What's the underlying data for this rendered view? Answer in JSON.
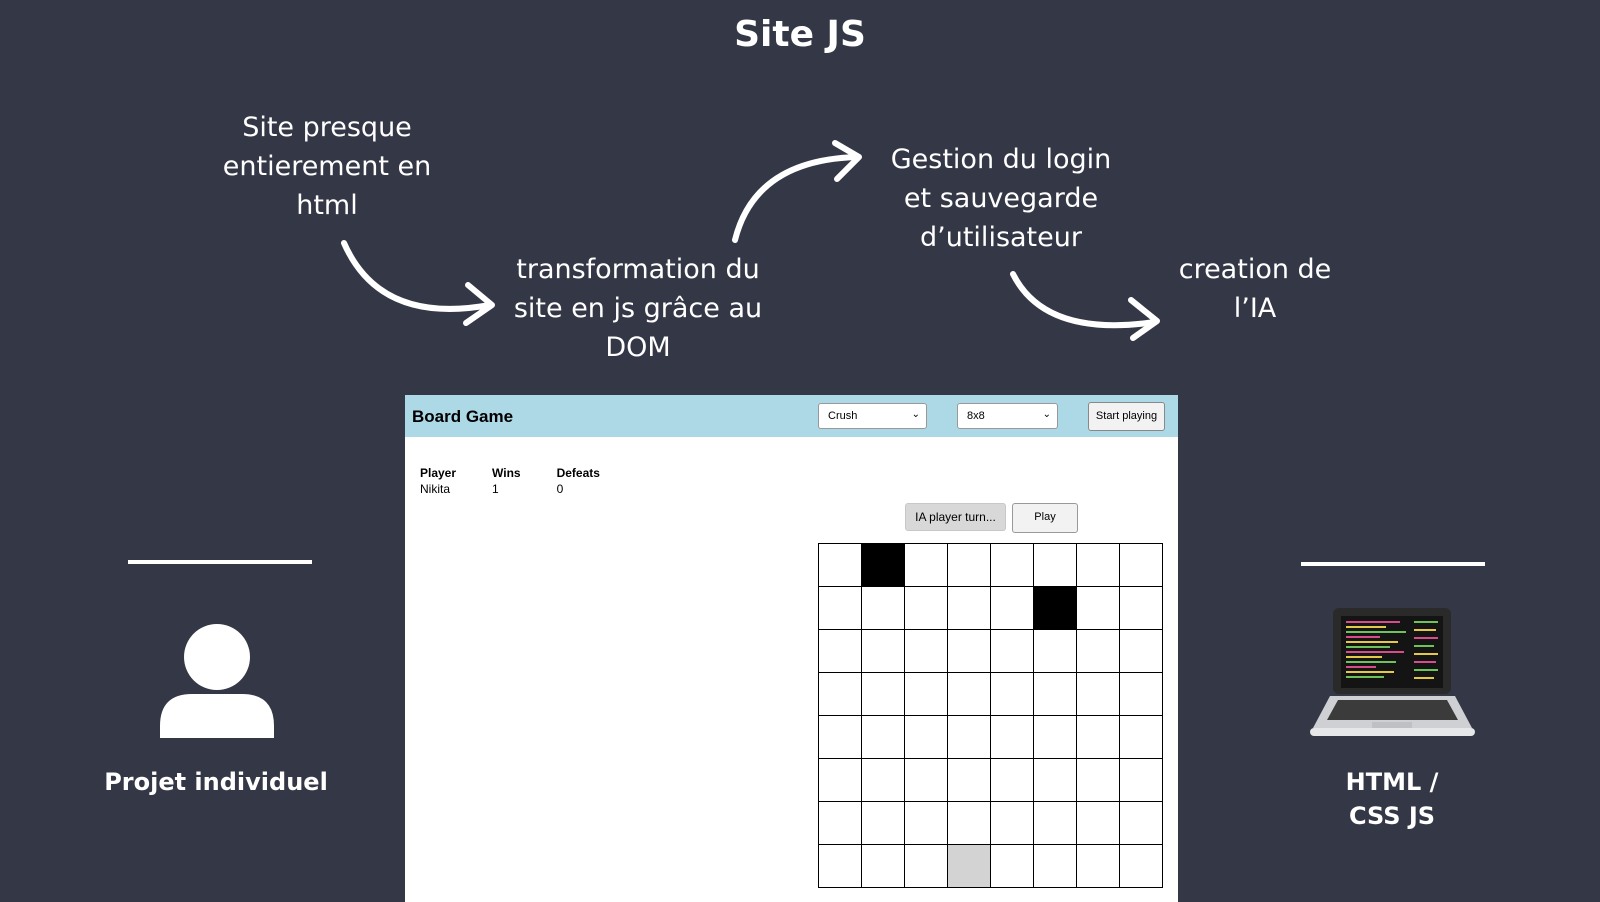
{
  "slide": {
    "title": "Site JS",
    "steps": [
      "Site presque entierement en html",
      "transformation du site en js grâce au DOM",
      "Gestion du login et sauvegarde d’utilisateur",
      "creation de l’IA"
    ],
    "left_caption": "Projet individuel",
    "right_caption": "HTML / CSS JS"
  },
  "app": {
    "title": "Board Game",
    "game_select": "Crush",
    "size_select": "8x8",
    "start_label": "Start playing",
    "stats": {
      "headers": [
        "Player",
        "Wins",
        "Defeats"
      ],
      "row": [
        "Nikita",
        "1",
        "0"
      ]
    },
    "ia_turn_label": "IA player turn...",
    "play_label": "Play",
    "board": {
      "size": 8,
      "black_cells": [
        [
          0,
          1
        ],
        [
          1,
          5
        ]
      ],
      "gray_cells": [
        [
          7,
          3
        ]
      ]
    }
  }
}
